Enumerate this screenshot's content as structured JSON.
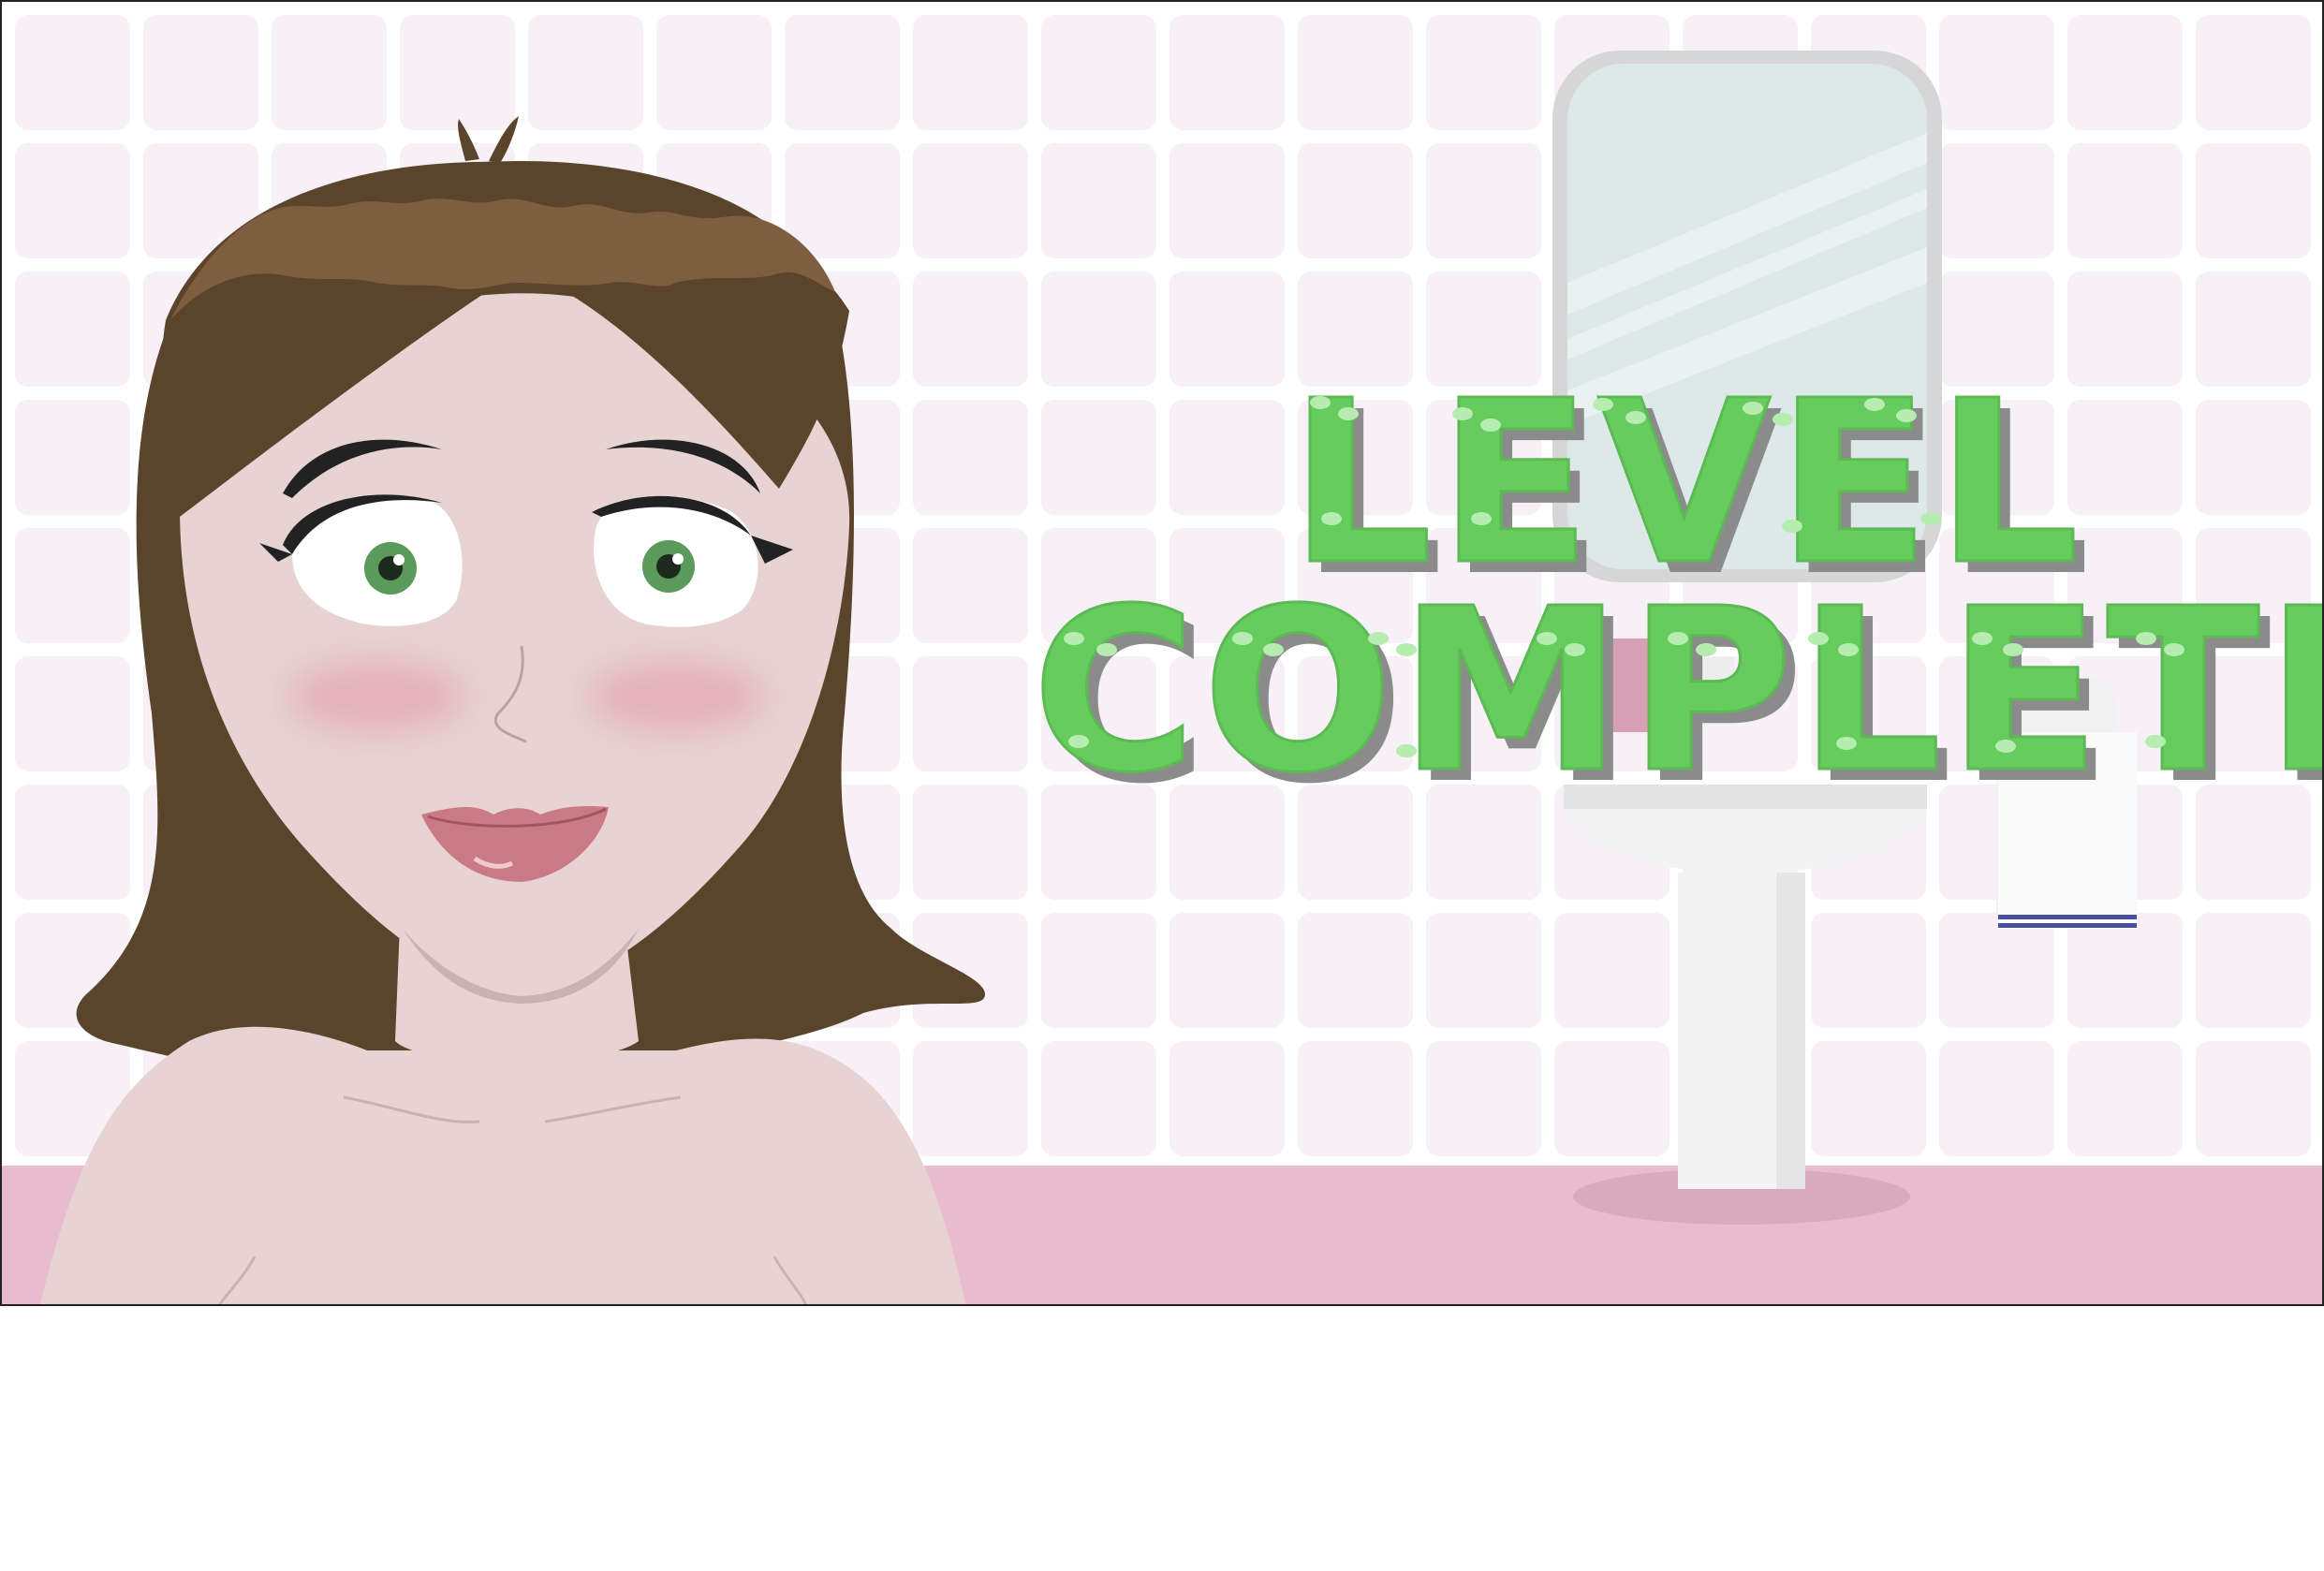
{
  "banner": {
    "line1": "LEVEL",
    "line2": "COMPLETE!"
  },
  "colors": {
    "banner_fill": "#66CC5E",
    "banner_shadow": "#8B8B8B",
    "banner_highlight": "#B7ECB0",
    "wall": "#F7F0F6",
    "tile_grout": "#FFFFFF",
    "floor": "#E8BCCE",
    "hair": "#5A442C",
    "hair_highlight": "#7D5E3E",
    "skin": "#E6D3D2",
    "skin_shadow": "#C8B3B1",
    "eye_iris": "#5A9A5A",
    "lips": "#C97A86",
    "blush": "#E4A6B2",
    "mirror_glass": "#DCE9E8",
    "mirror_frame": "#D6D6D6",
    "sink": "#F4F4F4",
    "sink_shadow": "#D7ABBC",
    "towel_stripe": "#4A4F9E"
  },
  "icons": {
    "character": "woman-portrait",
    "mirror": "bathroom-mirror",
    "sink": "pedestal-sink",
    "towel": "hanging-towel"
  }
}
